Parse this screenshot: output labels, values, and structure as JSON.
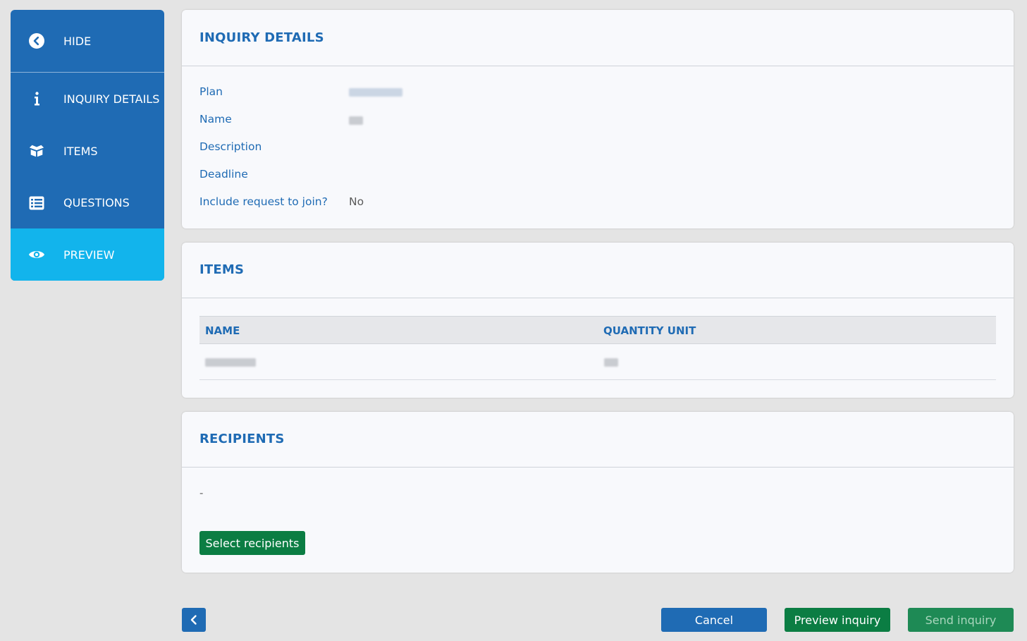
{
  "sidebar": {
    "hide_label": "HIDE",
    "items": [
      {
        "label": "INQUIRY DETAILS",
        "icon": "info-icon"
      },
      {
        "label": "ITEMS",
        "icon": "box-icon"
      },
      {
        "label": "QUESTIONS",
        "icon": "list-icon"
      },
      {
        "label": "PREVIEW",
        "icon": "eye-icon",
        "active": true
      }
    ]
  },
  "details": {
    "title": "INQUIRY DETAILS",
    "fields": [
      {
        "label": "Plan"
      },
      {
        "label": "Name"
      },
      {
        "label": "Description",
        "value": ""
      },
      {
        "label": "Deadline",
        "value": ""
      },
      {
        "label": "Include request to join?",
        "value": "No"
      }
    ]
  },
  "items": {
    "title": "ITEMS",
    "columns": [
      "NAME",
      "QUANTITY UNIT"
    ]
  },
  "recipients": {
    "title": "RECIPIENTS",
    "value": "-",
    "select_label": "Select recipients"
  },
  "footer": {
    "cancel_label": "Cancel",
    "preview_label": "Preview inquiry",
    "send_label": "Send inquiry"
  },
  "colors": {
    "primary": "#1f6bb4",
    "active": "#12b4ec",
    "green": "#0b7d43",
    "background": "#e4e4e4"
  }
}
